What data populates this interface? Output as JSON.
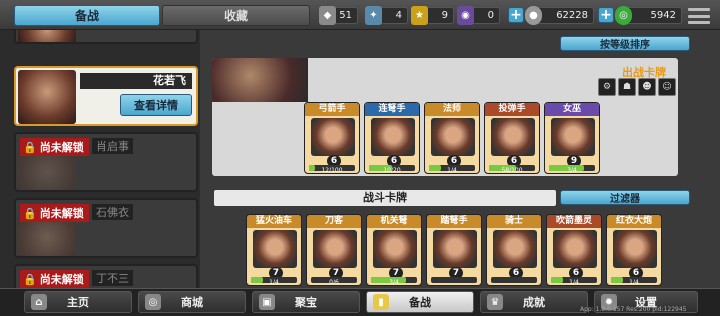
{
  "tabs": {
    "active": "备战",
    "inactive": "收藏"
  },
  "resources": [
    {
      "icon": "shield-icon",
      "value": "51",
      "color": "#8a8a8a"
    },
    {
      "icon": "crystal-icon",
      "value": "4",
      "color": "#5a8aaa"
    },
    {
      "icon": "gold-badge-icon",
      "value": "9",
      "color": "#c9a21a"
    },
    {
      "icon": "purple-badge-icon",
      "value": "0",
      "color": "#6a4a9a"
    },
    {
      "icon": "coin-icon",
      "value": "62228",
      "color": "#999"
    },
    {
      "icon": "gem-icon",
      "value": "5942",
      "color": "#3aaa3a"
    }
  ],
  "heroes": [
    {
      "name": "花若飞",
      "button": "查看详情",
      "locked": false
    },
    {
      "lock_label": "尚未解锁",
      "name": "肖启事",
      "locked": true
    },
    {
      "lock_label": "尚未解锁",
      "name": "石佛衣",
      "locked": true
    },
    {
      "lock_label": "尚未解锁",
      "name": "丁不三",
      "locked": true
    }
  ],
  "sort_button": "按等级排序",
  "deploy": {
    "label": "出战卡牌",
    "icons": [
      "filter-icon-1",
      "filter-icon-2",
      "filter-icon-3",
      "filter-icon-4"
    ],
    "cards": [
      {
        "name": "弓箭手",
        "cost": "6",
        "progress": "12/100",
        "fill": 0.12,
        "color": "#c98a2a"
      },
      {
        "name": "连弩手",
        "cost": "6",
        "progress": "10/20",
        "fill": 0.5,
        "color": "#2a6aaa"
      },
      {
        "name": "法师",
        "cost": "6",
        "progress": "1/4",
        "fill": 0.25,
        "color": "#c98a2a"
      },
      {
        "name": "投弹手",
        "cost": "6",
        "progress": "58/100",
        "fill": 0.58,
        "color": "#aa4a2a"
      },
      {
        "name": "女巫",
        "cost": "9",
        "progress": "3/4",
        "fill": 0.75,
        "color": "#6a4aaa"
      }
    ]
  },
  "battle": {
    "title": "战斗卡牌",
    "filter_button": "过滤器",
    "cards": [
      {
        "name": "猛火油车",
        "cost": "7",
        "progress": "1/4",
        "fill": 0.25,
        "color": "#c98a2a"
      },
      {
        "name": "刀客",
        "cost": "7",
        "progress": "0/6",
        "fill": 0.0,
        "color": "#c98a2a"
      },
      {
        "name": "机关弩",
        "cost": "7",
        "progress": "3/4",
        "fill": 0.75,
        "color": "#c98a2a"
      },
      {
        "name": "踏弩手",
        "cost": "7",
        "progress": "",
        "fill": 0.0,
        "color": "#c98a2a"
      },
      {
        "name": "骑士",
        "cost": "6",
        "progress": "",
        "fill": 0.0,
        "color": "#c98a2a"
      },
      {
        "name": "吹箭墨灵",
        "cost": "6",
        "progress": "1/4",
        "fill": 0.25,
        "color": "#aa4a2a"
      },
      {
        "name": "红衣大炮",
        "cost": "6",
        "progress": "1/4",
        "fill": 0.25,
        "color": "#c98a2a"
      }
    ]
  },
  "nav": [
    {
      "label": "主页",
      "icon": "home-icon",
      "active": false
    },
    {
      "label": "商城",
      "icon": "shop-icon",
      "active": false
    },
    {
      "label": "聚宝",
      "icon": "treasure-icon",
      "active": false
    },
    {
      "label": "备战",
      "icon": "cards-icon",
      "active": true
    },
    {
      "label": "成就",
      "icon": "trophy-icon",
      "active": false
    },
    {
      "label": "设置",
      "icon": "gear-icon",
      "active": false
    }
  ],
  "version": "App: 1.0.0.157 Res:200 pid:122945"
}
